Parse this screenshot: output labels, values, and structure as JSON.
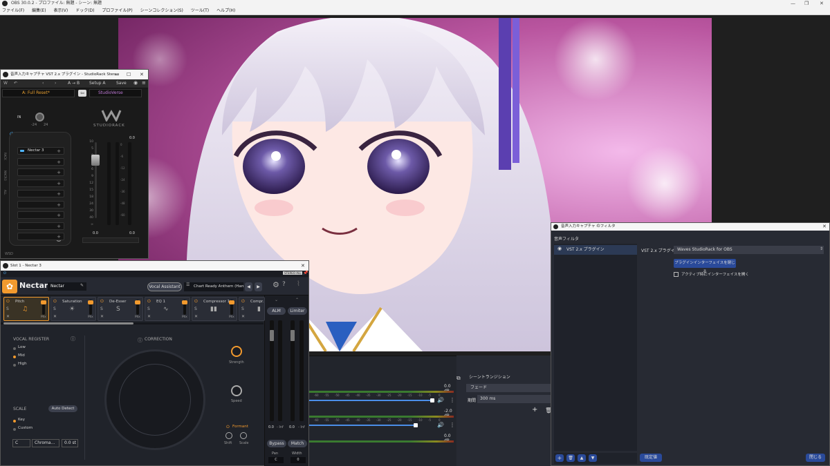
{
  "obs": {
    "title": "OBS 30.0.2 - プロファイル: 無題 - シーン: 無題",
    "menu": [
      "ファイル(F)",
      "編集(E)",
      "表示(V)",
      "ドック(D)",
      "プロファイル(P)",
      "シーンコレクション(S)",
      "ツール(T)",
      "ヘルプ(H)"
    ],
    "window_controls": [
      "—",
      "❐",
      "✕"
    ]
  },
  "mixer": {
    "rows": [
      {
        "db": "0.0 dB"
      },
      {
        "db": "-2.0 dB"
      },
      {
        "db": "0.0 dB"
      }
    ],
    "scale": [
      "-60",
      "-55",
      "-50",
      "-45",
      "-40",
      "-35",
      "-30",
      "-25",
      "-20",
      "-15",
      "-10",
      "-5",
      "0"
    ]
  },
  "transitions": {
    "header": "シーントランジション",
    "type": "フェード",
    "duration_label": "期間",
    "duration_value": "300 ms"
  },
  "studiorack": {
    "title": "音声入力キャプチャ VST 2.x プラグイン - StudioRack Stereo",
    "preset": "A: Full Reset*",
    "toolbar": {
      "ab": "A → B",
      "setup": "Setup A",
      "save": "Save"
    },
    "rack_name": "StudioVerse",
    "logo": "STUDIORACK",
    "io_label": "IN",
    "io_ticks": [
      "-24",
      "24"
    ],
    "rack_slots": [
      "Nectar 3",
      "",
      "",
      "",
      "",
      "",
      "",
      "",
      ""
    ],
    "side_labels": [
      "RACK",
      "MACRO",
      "ALL"
    ],
    "meter_scale": [
      "10",
      "5",
      "0",
      "3",
      "6",
      "9",
      "12",
      "15",
      "18",
      "24",
      "30",
      "40",
      "∞"
    ],
    "meter_right_scale": [
      "0",
      "-6",
      "-12",
      "-24",
      "-36",
      "-48",
      "-60"
    ],
    "fader_reading": "0.0",
    "meter_reading_top": "0.0",
    "meter_reading_bottom": "0.0",
    "footer": "WSD"
  },
  "nectar": {
    "title": "Slot 1 - Nectar 3",
    "badge": "STEREO ALL",
    "logo": "Nectar",
    "preset_field": "Nectar",
    "vocal_assistant": "Vocal Assistant",
    "preset_name": "Chart Ready Anthem (Harm...",
    "modules": [
      {
        "name": "Pitch",
        "mix": "Mix"
      },
      {
        "name": "Saturation",
        "mix": "Mix"
      },
      {
        "name": "De-Esser",
        "mix": "Mix"
      },
      {
        "name": "EQ 1",
        "mix": "Mix"
      },
      {
        "name": "Compressor 1",
        "mix": "Mix"
      },
      {
        "name": "Compr...",
        "mix": ""
      }
    ],
    "alm": "ALM",
    "limiter": "Limiter",
    "vocal_register": {
      "label": "VOCAL REGISTER",
      "options": [
        "Low",
        "Mid",
        "High"
      ],
      "selected": "Mid"
    },
    "correction": "CORRECTION",
    "strength": "Strength",
    "speed": "Speed",
    "formant": "Formant",
    "shift": "Shift",
    "scale_knob": "Scale",
    "scale": {
      "label": "SCALE",
      "auto_detect": "Auto Detect",
      "options": [
        "Key",
        "Custom"
      ],
      "selected": "Key",
      "key": "C",
      "mode": "Chroma...",
      "offset": "0.0 st"
    },
    "meters": {
      "left": "0.0",
      "left_inf": "- Inf",
      "right": "0.0",
      "right_inf": "- Inf"
    },
    "bypass": "Bypass",
    "match": "Match",
    "pan_label": "Pan",
    "pan_value": "C",
    "width_label": "Width",
    "width_value": "0"
  },
  "filters": {
    "title": "音声入力キャプチャ のフィルタ",
    "section": "音声フィルタ",
    "items": [
      "VST 2.x プラグイン"
    ],
    "plugin_label": "VST 2.x プラグイン",
    "plugin_value": "Waves StudioRack for OBS",
    "close_ui": "プラグインインターフェイスを閉じる",
    "checkbox_label": "アクティブ時にインターフェイスを開く",
    "defaults": "既定値",
    "close": "閉じる"
  }
}
